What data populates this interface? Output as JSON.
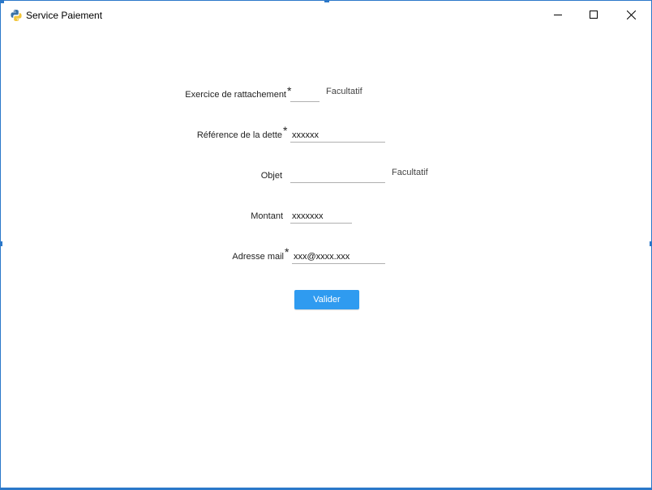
{
  "window": {
    "title": "Service Paiement",
    "icon": "python-icon"
  },
  "titlebar_buttons": {
    "minimize": "minimize-icon",
    "maximize": "maximize-icon",
    "close": "close-icon"
  },
  "form": {
    "exercice": {
      "label": "Exercice de rattachement",
      "required_mark": "*",
      "value": "",
      "hint": "Facultatif"
    },
    "reference": {
      "label": "Référence de la dette",
      "required_mark": "*",
      "value": "xxxxxx"
    },
    "objet": {
      "label": "Objet",
      "value": "",
      "hint": "Facultatif"
    },
    "montant": {
      "label": "Montant",
      "value": "xxxxxxx"
    },
    "email": {
      "label": "Adresse mail",
      "required_mark": "*",
      "value": "xxx@xxxx.xxx"
    },
    "submit_label": "Valider"
  },
  "colors": {
    "accent": "#2f9bf0",
    "window_border": "#2b78c9"
  }
}
